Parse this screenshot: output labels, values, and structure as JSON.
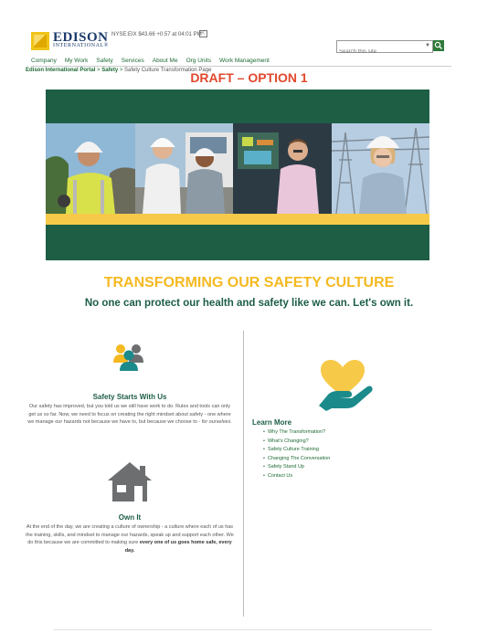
{
  "header": {
    "logo_name": "EDISON",
    "logo_sub": "INTERNATIONAL®",
    "ticker": "NYSE:EIX  $43.66 +0.57  at  04:01 PM",
    "search_placeholder": "Search this site"
  },
  "nav": {
    "items": [
      "Company",
      "My Work",
      "Safety",
      "Services",
      "About Me",
      "Org Units",
      "Work Management"
    ]
  },
  "breadcrumb": {
    "items": [
      "Edison International Portal",
      "Safety"
    ],
    "separator": " > ",
    "current": "Safety Culture Transformation Page"
  },
  "draft_label": "DRAFT – OPTION 1",
  "page": {
    "title": "TRANSFORMING OUR SAFETY CULTURE",
    "subtitle": "No one can protect our health and safety like we can. Let's own it."
  },
  "safety_starts": {
    "heading": "Safety Starts With Us",
    "body": "Our safety has improved, but you told us we still have work to do. Rules and tools can only get us so far. Now, we need to focus on creating the right mindset about safety - one where we manage our hazards not because we have to, but because we choose to - ",
    "body_em": "for ourselves."
  },
  "own_it": {
    "heading": "Own It",
    "body": "At the end of the day, we are creating a culture of ownership - a culture where each of us has the training, skills, and mindset to manage our hazards, speak up and support each other.  We do this because we are committed to making sure ",
    "body_strong": "every one of us goes home safe, every day."
  },
  "learn_more": {
    "heading": "Learn More",
    "links": [
      "Why The Transformation?",
      "What's Changing?",
      "Safety Culture Training",
      "Changing The Conversation",
      "Safety Stand Up",
      "Contact Us"
    ]
  },
  "colors": {
    "brand_green": "#1d5e45",
    "accent_yellow": "#f5b921",
    "draft_red": "#e0492d",
    "link_green": "#1e6b34"
  },
  "icons": [
    "people-group-icon",
    "house-icon",
    "heart-hand-icon",
    "search-icon"
  ]
}
